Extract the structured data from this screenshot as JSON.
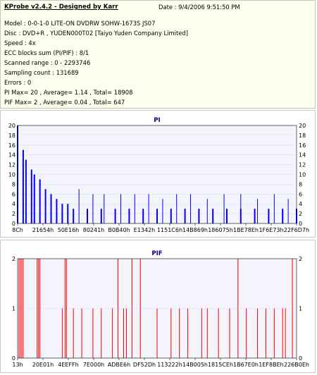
{
  "header": {
    "title": "KProbe v2.4.2 - Designed by Karr",
    "date": "Date : 9/4/2006 9:51:50 PM"
  },
  "info": [
    "Model : 0-0-1-0 LITE-ON DVDRW SOHW-1673S JS07",
    "Disc : DVD+R , YUDEN000T02 [Taiyo Yuden Company Limited]",
    "Speed : 4x",
    "ECC blocks sum (PI/PIF) : 8/1",
    "Scanned range : 0 - 2293746",
    "Sampling count : 131689",
    "Errors : 0",
    "PI Max= 20 , Average= 1.14 , Total= 18908",
    "PIF Max= 2 , Average= 0.04 , Total= 647"
  ],
  "colors": {
    "pi": "#0000ff",
    "pif": "#ff0000",
    "frame": "#c0c0c0",
    "plot_bg": "#f4f4fc",
    "grid": "#c8c8ff"
  },
  "chart_data": [
    {
      "type": "area",
      "title": "PI",
      "ylim": [
        0,
        20
      ],
      "yticks": [
        0,
        2,
        4,
        6,
        8,
        10,
        12,
        14,
        16,
        18,
        20
      ],
      "xtick_labels": [
        "8Ch",
        "21654h",
        "50E16h",
        "80241h",
        "B0B40h",
        "E1342h",
        "1151C6h",
        "14B869h",
        "186075h",
        "1BE78Eh",
        "1F6E73h",
        "22F6D7h"
      ],
      "x_positions": [
        0.0,
        0.0,
        0.02,
        0.03,
        0.05,
        0.06,
        0.08,
        0.1,
        0.12,
        0.14,
        0.16,
        0.18,
        0.2,
        0.25,
        0.3,
        0.35,
        0.4,
        0.45,
        0.5,
        0.55,
        0.6,
        0.65,
        0.7,
        0.75,
        0.8,
        0.85,
        0.9,
        0.95,
        1.0
      ],
      "values": [
        20,
        19,
        15,
        13,
        11,
        10,
        9,
        7,
        6,
        5,
        4,
        4,
        3,
        3,
        3,
        3,
        3,
        3,
        3,
        3,
        3,
        3,
        3,
        3,
        3,
        3,
        3,
        3,
        3
      ],
      "spike_positions": [
        0.22,
        0.27,
        0.31,
        0.37,
        0.42,
        0.47,
        0.52,
        0.57,
        0.62,
        0.68,
        0.74,
        0.8,
        0.86,
        0.92,
        0.97
      ],
      "spike_values": [
        7,
        6,
        6,
        6,
        6,
        6,
        5,
        6,
        6,
        5,
        6,
        6,
        5,
        6,
        5
      ]
    },
    {
      "type": "bar",
      "title": "PIF",
      "ylim": [
        0,
        2
      ],
      "yticks": [
        0,
        1,
        2
      ],
      "xtick_labels": [
        "13h",
        "20E01h",
        "4EEFFh",
        "7E000h",
        "ADBE6h",
        "DF52Dh",
        "113222h",
        "14B005h",
        "1815CEh",
        "1B67E0h",
        "1EF8BEh",
        "226B0Eh"
      ],
      "x_positions": [
        0.005,
        0.01,
        0.015,
        0.02,
        0.07,
        0.075,
        0.08,
        0.16,
        0.17,
        0.175,
        0.2,
        0.23,
        0.27,
        0.3,
        0.34,
        0.36,
        0.38,
        0.39,
        0.41,
        0.44,
        0.5,
        0.55,
        0.58,
        0.61,
        0.66,
        0.68,
        0.72,
        0.76,
        0.79,
        0.82,
        0.86,
        0.89,
        0.92,
        0.95,
        0.96,
        0.985
      ],
      "values": [
        2,
        2,
        2,
        2,
        2,
        2,
        2,
        1,
        2,
        2,
        1,
        1,
        1,
        1,
        1,
        2,
        1,
        1,
        2,
        2,
        1,
        1,
        1,
        1,
        1,
        1,
        1,
        1,
        2,
        1,
        1,
        1,
        1,
        1,
        1,
        2
      ]
    }
  ]
}
